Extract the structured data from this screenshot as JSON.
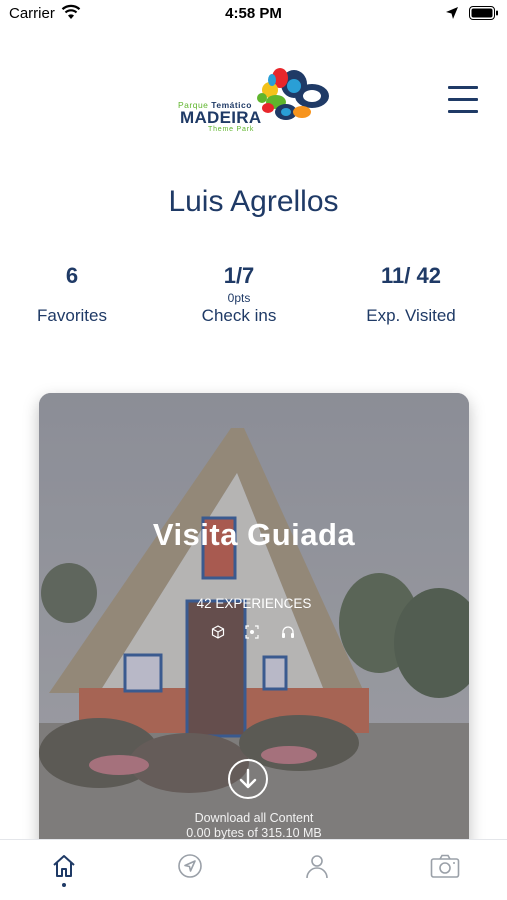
{
  "status_bar": {
    "carrier": "Carrier",
    "time": "4:58 PM"
  },
  "logo": {
    "line1_prefix": "Parque ",
    "line1_bold": "Temático",
    "line2": "MADEIRA",
    "line3": "Theme Park"
  },
  "profile": {
    "name": "Luis Agrellos"
  },
  "stats": {
    "favorites_value": "6",
    "favorites_label": "Favorites",
    "checkins_value": "1/7",
    "checkins_points": "0pts",
    "checkins_label": "Check ins",
    "visited_value": "11/ 42",
    "visited_label": "Exp. Visited"
  },
  "card": {
    "title": "Visita Guiada",
    "experiences": "42 EXPERIENCES",
    "icons": [
      "cube-icon",
      "scan-icon",
      "headphones-icon"
    ],
    "download_label": "Download all Content",
    "download_progress": "0.00 bytes of 315.10 MB"
  },
  "tab_bar": {
    "tabs": [
      "home-icon",
      "navigation-icon",
      "user-icon",
      "camera-icon"
    ],
    "active": "home-icon"
  },
  "colors": {
    "primary": "#1f3a66",
    "accent_green": "#5fb52c"
  }
}
